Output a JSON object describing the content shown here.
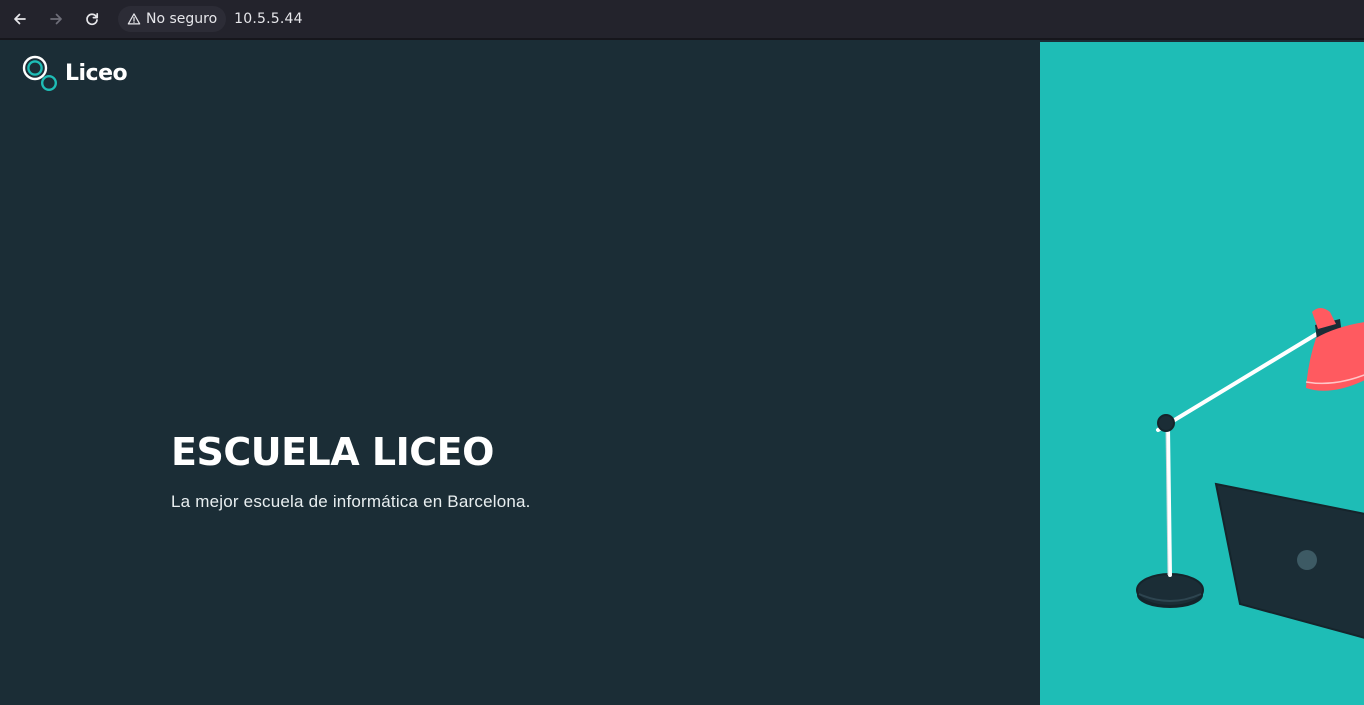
{
  "browser": {
    "back_icon": "arrow-left-icon",
    "forward_icon": "arrow-right-icon",
    "reload_icon": "reload-icon",
    "security_icon": "warning-triangle-icon",
    "security_label": "No seguro",
    "url": "10.5.5.44"
  },
  "site": {
    "logo_text": "Liceo",
    "hero_title": "ESCUELA LICEO",
    "hero_subtitle": "La mejor escuela de informática en Barcelona."
  },
  "colors": {
    "dark_bg": "#1b2d36",
    "teal_bg": "#1ebdb6",
    "lamp_red": "#ff5a60",
    "browser_bar": "#23232c"
  }
}
